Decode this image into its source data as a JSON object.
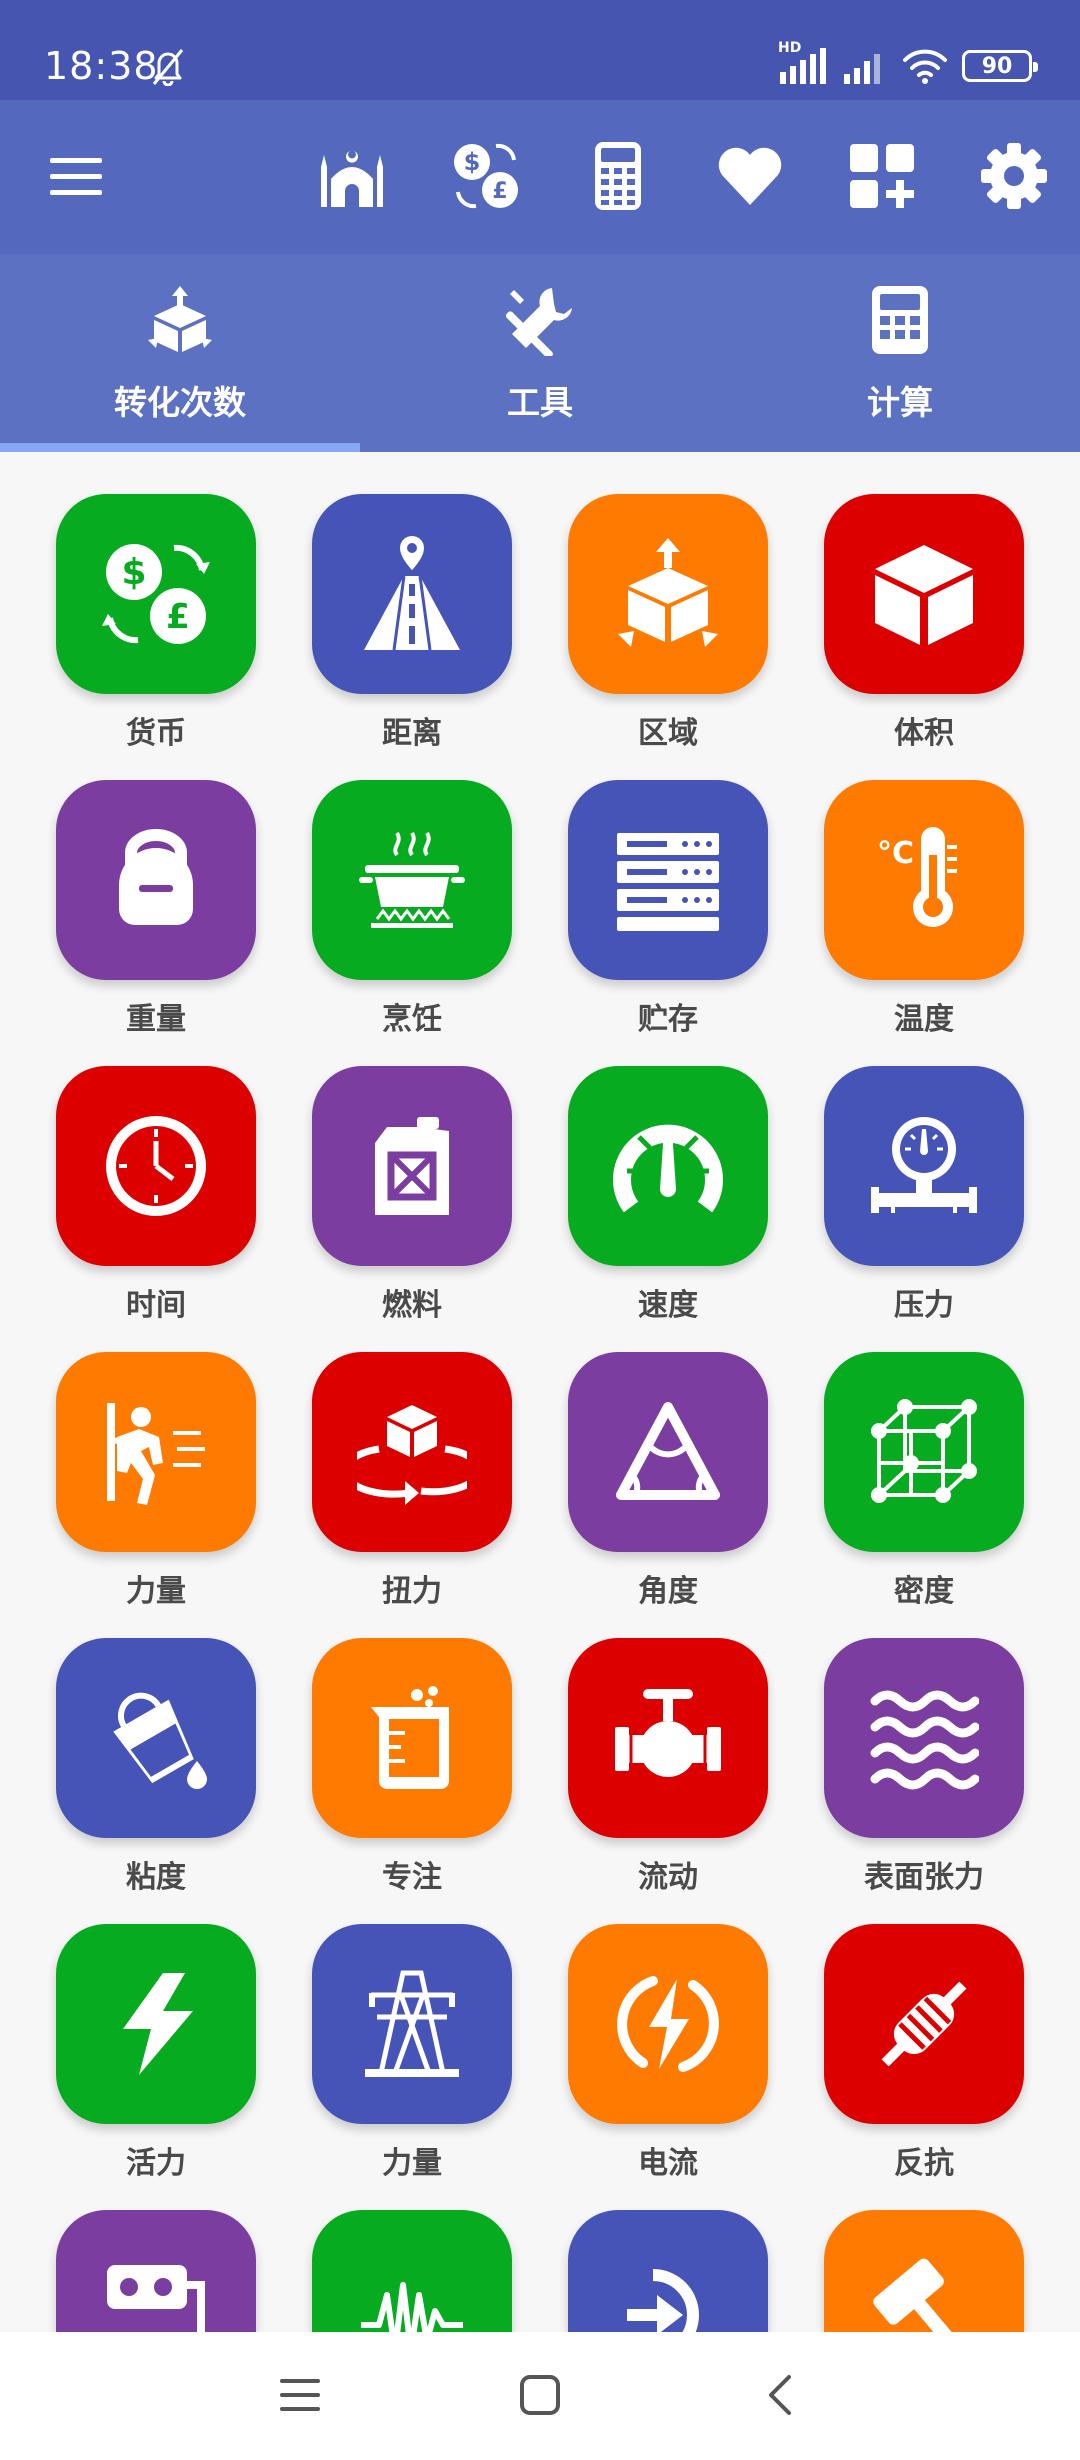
{
  "status_bar": {
    "time": "18:38",
    "network_label": "HD",
    "battery_level": "90"
  },
  "toolbar": {
    "icons": [
      "menu-icon",
      "mosque-icon",
      "currency-exchange-icon",
      "calculator-device-icon",
      "heart-icon",
      "add-widget-icon",
      "gear-icon"
    ]
  },
  "tabs": [
    {
      "label": "转化次数",
      "icon": "conversion-icon",
      "selected": true
    },
    {
      "label": "工具",
      "icon": "tools-icon",
      "selected": false
    },
    {
      "label": "计算",
      "icon": "calculator-icon",
      "selected": false
    }
  ],
  "colors": {
    "green": "#07ab20",
    "blue": "#4654b8",
    "orange": "#fe7a00",
    "red": "#dd0000",
    "purple": "#7b3ea0"
  },
  "units": [
    {
      "label": "货币",
      "icon": "currency-icon",
      "color": "#07ab20"
    },
    {
      "label": "距离",
      "icon": "road-pin-icon",
      "color": "#4654b8"
    },
    {
      "label": "区域",
      "icon": "area-box-icon",
      "color": "#fe7a00"
    },
    {
      "label": "体积",
      "icon": "cube-icon",
      "color": "#dd0000"
    },
    {
      "label": "重量",
      "icon": "kettlebell-icon",
      "color": "#7b3ea0"
    },
    {
      "label": "烹饪",
      "icon": "cooking-pot-icon",
      "color": "#07ab20"
    },
    {
      "label": "贮存",
      "icon": "storage-server-icon",
      "color": "#4654b8"
    },
    {
      "label": "温度",
      "icon": "thermometer-icon",
      "color": "#fe7a00"
    },
    {
      "label": "时间",
      "icon": "clock-icon",
      "color": "#dd0000"
    },
    {
      "label": "燃料",
      "icon": "fuel-can-icon",
      "color": "#7b3ea0"
    },
    {
      "label": "速度",
      "icon": "speedometer-icon",
      "color": "#07ab20"
    },
    {
      "label": "压力",
      "icon": "pressure-gauge-icon",
      "color": "#4654b8"
    },
    {
      "label": "力量",
      "icon": "pushing-person-icon",
      "color": "#fe7a00"
    },
    {
      "label": "扭力",
      "icon": "torque-icon",
      "color": "#dd0000"
    },
    {
      "label": "角度",
      "icon": "angle-triangle-icon",
      "color": "#7b3ea0"
    },
    {
      "label": "密度",
      "icon": "density-lattice-icon",
      "color": "#07ab20"
    },
    {
      "label": "粘度",
      "icon": "pouring-bucket-icon",
      "color": "#4654b8"
    },
    {
      "label": "专注",
      "icon": "beaker-icon",
      "color": "#fe7a00"
    },
    {
      "label": "流动",
      "icon": "valve-icon",
      "color": "#dd0000"
    },
    {
      "label": "表面张力",
      "icon": "waves-icon",
      "color": "#7b3ea0"
    },
    {
      "label": "活力",
      "icon": "lightning-icon",
      "color": "#07ab20"
    },
    {
      "label": "力量",
      "icon": "power-tower-icon",
      "color": "#4654b8"
    },
    {
      "label": "电流",
      "icon": "electric-current-icon",
      "color": "#fe7a00"
    },
    {
      "label": "反抗",
      "icon": "resistor-icon",
      "color": "#dd0000"
    },
    {
      "label": "",
      "icon": "power-strip-icon",
      "color": "#7b3ea0"
    },
    {
      "label": "",
      "icon": "frequency-wave-icon",
      "color": "#07ab20"
    },
    {
      "label": "",
      "icon": "plug-icon",
      "color": "#4654b8"
    },
    {
      "label": "",
      "icon": "hammer-icon",
      "color": "#fe7a00"
    }
  ],
  "nav_bar": {
    "icons": [
      "recents-icon",
      "home-icon",
      "back-icon"
    ]
  }
}
